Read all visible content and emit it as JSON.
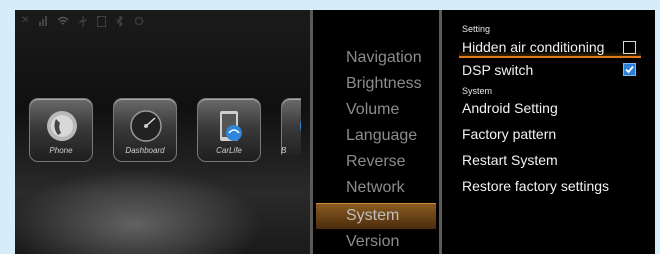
{
  "status_bar": {
    "icons": [
      "close-icon",
      "signal-icon",
      "wifi-icon",
      "usb-icon",
      "sd-card-icon",
      "bluetooth-icon",
      "settings-icon"
    ]
  },
  "home": {
    "apps": [
      {
        "label": "Phone",
        "icon": "phone-app-icon"
      },
      {
        "label": "Dashboard",
        "icon": "dashboard-app-icon"
      },
      {
        "label": "CarLife",
        "icon": "carlife-app-icon"
      },
      {
        "label": "B",
        "icon": "partial-app-icon"
      }
    ]
  },
  "menu": {
    "items": [
      "Navigation",
      "Brightness",
      "Volume",
      "Language",
      "Reverse",
      "Network",
      "System",
      "Version"
    ],
    "selected": "System"
  },
  "settings": {
    "section_setting": "Setting",
    "hidden_air_label": "Hidden air conditioning",
    "hidden_air_checked": false,
    "dsp_label": "DSP switch",
    "dsp_checked": true,
    "section_system": "System",
    "android_label": "Android Setting",
    "factory_pattern_label": "Factory pattern",
    "restart_label": "Restart System",
    "restore_label": "Restore factory settings"
  },
  "colors": {
    "accent": "#e07a1a",
    "checkbox_checked": "#2a7fd6",
    "menu_text": "#8c8c8c"
  }
}
